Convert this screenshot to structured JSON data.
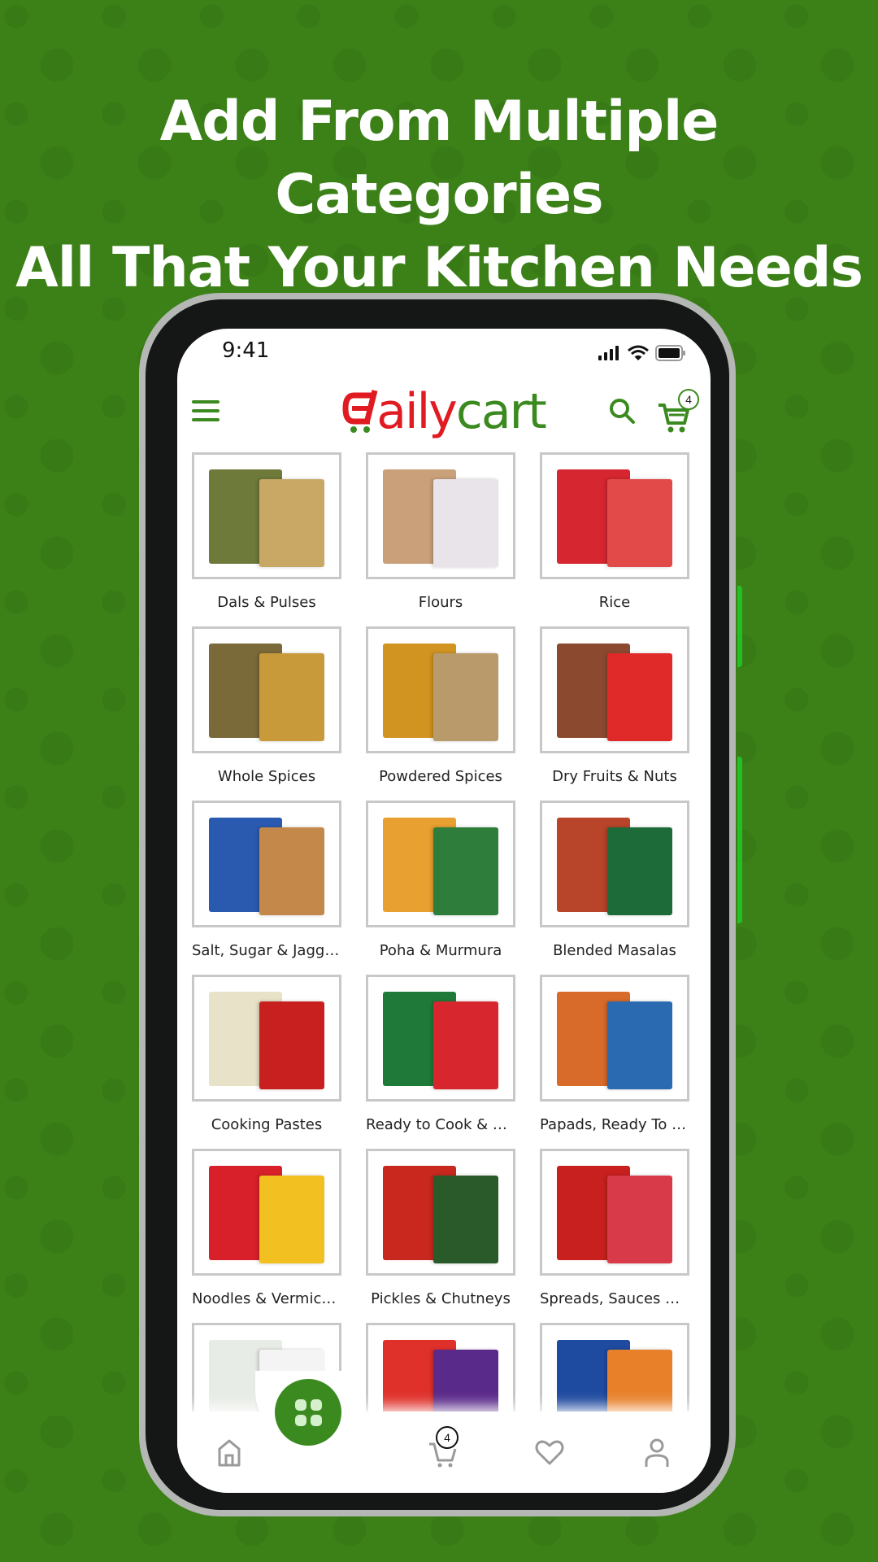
{
  "headline": {
    "line1": "Add From Multiple Categories",
    "line2": "All That Your Kitchen Needs"
  },
  "status_bar": {
    "time": "9:41",
    "icons": [
      "signal-icon",
      "wifi-icon",
      "battery-icon"
    ]
  },
  "app_header": {
    "menu_icon": "hamburger-icon",
    "logo": {
      "part1": "d",
      "part2": "aily",
      "part3": "cart"
    },
    "search_icon": "search-icon",
    "cart_icon": "cart-icon",
    "cart_count": "4"
  },
  "categories": [
    {
      "label": "Dals & Pulses",
      "colors": [
        "#6d7a3a",
        "#c9a866"
      ]
    },
    {
      "label": "Flours",
      "colors": [
        "#c9a07a",
        "#e8e4ea"
      ]
    },
    {
      "label": "Rice",
      "colors": [
        "#d6262f",
        "#e24a4a"
      ]
    },
    {
      "label": "Whole Spices",
      "colors": [
        "#7a6a3a",
        "#c89a3a"
      ]
    },
    {
      "label": "Powdered Spices",
      "colors": [
        "#d19420",
        "#b99a6a"
      ]
    },
    {
      "label": "Dry Fruits & Nuts",
      "colors": [
        "#8b4a30",
        "#e02a2a"
      ]
    },
    {
      "label": "Salt, Sugar & Jaggery",
      "colors": [
        "#2a5ab0",
        "#c4884a"
      ]
    },
    {
      "label": "Poha & Murmura",
      "colors": [
        "#e8a030",
        "#2f7d3a"
      ]
    },
    {
      "label": "Blended Masalas",
      "colors": [
        "#b8442a",
        "#1e6b3a"
      ]
    },
    {
      "label": "Cooking Pastes",
      "colors": [
        "#e8e2c8",
        "#c8201e"
      ]
    },
    {
      "label": "Ready to Cook & Eat",
      "colors": [
        "#1f7a3a",
        "#d8262e"
      ]
    },
    {
      "label": "Papads, Ready To Fry",
      "colors": [
        "#d86a2a",
        "#2a6ab0"
      ]
    },
    {
      "label": "Noodles & Vermicelli",
      "colors": [
        "#d8202a",
        "#f2c020"
      ]
    },
    {
      "label": "Pickles & Chutneys",
      "colors": [
        "#c8281e",
        "#2a5a2a"
      ]
    },
    {
      "label": "Spreads, Sauces & …",
      "colors": [
        "#c8201e",
        "#d83a4a"
      ]
    },
    {
      "label": "",
      "colors": [
        "#e8ece6",
        "#f4f4f4"
      ]
    },
    {
      "label": "",
      "colors": [
        "#e0302a",
        "#5a2a8a"
      ]
    },
    {
      "label": "",
      "colors": [
        "#1e4aa0",
        "#e8802a"
      ]
    }
  ],
  "bottom_nav": {
    "items": [
      {
        "name": "home",
        "icon": "home-icon"
      },
      {
        "name": "categories",
        "icon": "grid-icon"
      },
      {
        "name": "cart",
        "icon": "cart-icon",
        "badge": "4"
      },
      {
        "name": "wishlist",
        "icon": "heart-icon"
      },
      {
        "name": "profile",
        "icon": "user-icon"
      }
    ]
  },
  "colors": {
    "background": "#3b8118",
    "brand_green": "#3b8a1f",
    "brand_red": "#e01b22",
    "phone_bezel": "#151716",
    "phone_frame": "#b5b7b5"
  }
}
